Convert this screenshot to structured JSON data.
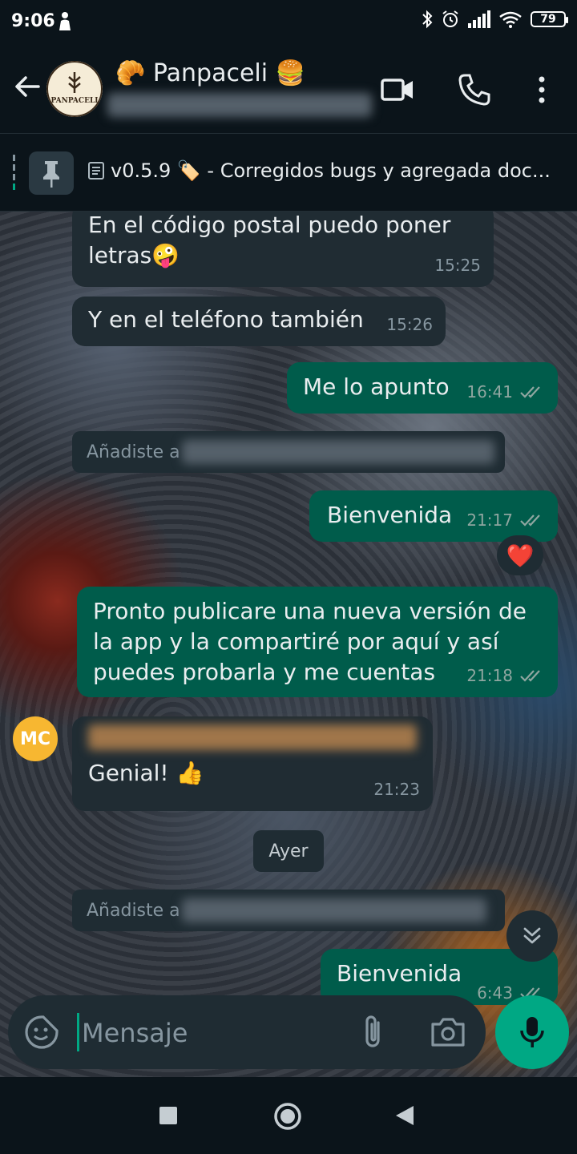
{
  "status_bar": {
    "time": "9:06",
    "battery": "79"
  },
  "header": {
    "title": "🥐 Panpaceli 🍔",
    "avatar_text": "PANPACELI"
  },
  "pinned": {
    "text": "v0.5.9 🏷️ - Corregidos bugs y agregada doc..."
  },
  "messages": {
    "m1": {
      "text": "En el código postal puedo poner letras🤪",
      "time": "15:25"
    },
    "m2": {
      "text": "Y en el teléfono también",
      "time": "15:26"
    },
    "m3": {
      "text": "Me lo apunto",
      "time": "16:41"
    },
    "sys1": {
      "prefix": "Añadiste a"
    },
    "m4": {
      "text": "Bienvenida",
      "time": "21:17",
      "reaction": "❤️"
    },
    "m5": {
      "text": "Pronto publicare una nueva versión de la app y la compartiré por aquí y así puedes probarla y me cuentas",
      "time": "21:18"
    },
    "m6": {
      "avatar": "MC",
      "text": "Genial! 👍",
      "time": "21:23"
    },
    "date_chip": "Ayer",
    "sys2": {
      "prefix": "Añadiste a"
    },
    "m7": {
      "text": "Bienvenida",
      "time": "6:43"
    }
  },
  "composer": {
    "placeholder": "Mensaje"
  },
  "colors": {
    "accent": "#00a884",
    "outgoing": "#005c4b",
    "incoming": "#202c33",
    "avatar_mc": "#f7b731"
  }
}
